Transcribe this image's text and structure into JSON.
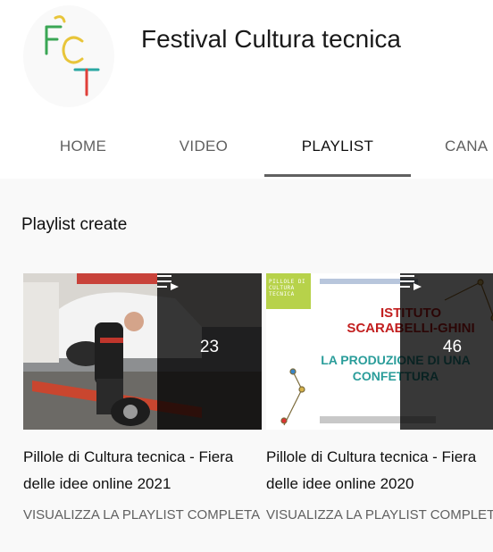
{
  "channel": {
    "title": "Festival Cultura tecnica",
    "logo_text": "FCT"
  },
  "tabs": [
    {
      "label": "HOME",
      "active": false
    },
    {
      "label": "VIDEO",
      "active": false
    },
    {
      "label": "PLAYLIST",
      "active": true
    },
    {
      "label": "CANA",
      "active": false
    }
  ],
  "section": {
    "title": "Playlist create"
  },
  "playlists": [
    {
      "count": "23",
      "title": "Pillole di Cultura tecnica - Fiera delle idee online 2021",
      "link": "VISUALIZZA LA PLAYLIST COMPLETA",
      "thumbnail": "man-lifting-car-wheel-in-workshop"
    },
    {
      "count": "46",
      "title": "Pillole di Cultura tecnica - Fiera delle idee online 2020",
      "link": "VISUALIZZA LA PLAYLIST COMPLETA",
      "thumbnail_text": {
        "badge": "PILLOLE DI CULTURA TECNICA",
        "line1": "ISTITUTO",
        "line2": "SCARABELLI-GHINI",
        "line3": "LA PRODUZIONE DI UNA",
        "line4": "CONFETTURA"
      }
    }
  ],
  "icons": {
    "playlist": "playlist-play-icon"
  },
  "colors": {
    "tab_active": "#0f0f0f",
    "tab_inactive": "#606060",
    "title_red": "#c21f1f",
    "title_teal": "#2a9d9a",
    "logo_green": "#3aa655",
    "logo_yellow": "#e8c53a",
    "logo_red": "#e0403a",
    "logo_teal": "#2aa7a2"
  }
}
